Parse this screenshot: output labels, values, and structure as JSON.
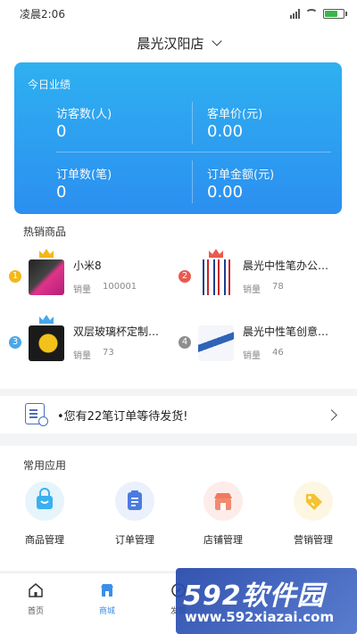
{
  "status_bar": {
    "time": "凌晨2:06"
  },
  "header": {
    "store_name": "晨光汉阳店"
  },
  "stats": {
    "title": "今日业绩",
    "visitors_label": "访客数(人)",
    "visitors_value": "0",
    "avg_price_label": "客单价(元)",
    "avg_price_value": "0.00",
    "orders_label": "订单数(笔)",
    "orders_value": "0",
    "amount_label": "订单金额(元)",
    "amount_value": "0.00"
  },
  "hot_products": {
    "title": "热销商品",
    "sales_label": "销量",
    "items": [
      {
        "rank": "1",
        "name": "小米8",
        "sales": "100001",
        "rank_color": "#f2b71c"
      },
      {
        "rank": "2",
        "name": "晨光中性笔办公…",
        "sales": "78",
        "rank_color": "#e85b4f"
      },
      {
        "rank": "3",
        "name": "双层玻璃杯定制…",
        "sales": "73",
        "rank_color": "#4aa7e8"
      },
      {
        "rank": "4",
        "name": "晨光中性笔创意…",
        "sales": "46",
        "rank_color": "#8e8e8e"
      }
    ]
  },
  "notice": {
    "text": "•您有22笔订单等待发货!"
  },
  "apps": {
    "title": "常用应用",
    "items": [
      {
        "label": "商品管理",
        "icon": "shopping-bag-icon"
      },
      {
        "label": "订单管理",
        "icon": "clipboard-icon"
      },
      {
        "label": "店铺管理",
        "icon": "storefront-icon"
      },
      {
        "label": "营销管理",
        "icon": "tag-icon"
      }
    ]
  },
  "tabbar": {
    "home": "首页",
    "mall": "商城",
    "discover": "发现",
    "active_color": "#3a8fe8"
  },
  "watermark": {
    "big": "592软件园",
    "url": "www.592xiazai.com"
  }
}
